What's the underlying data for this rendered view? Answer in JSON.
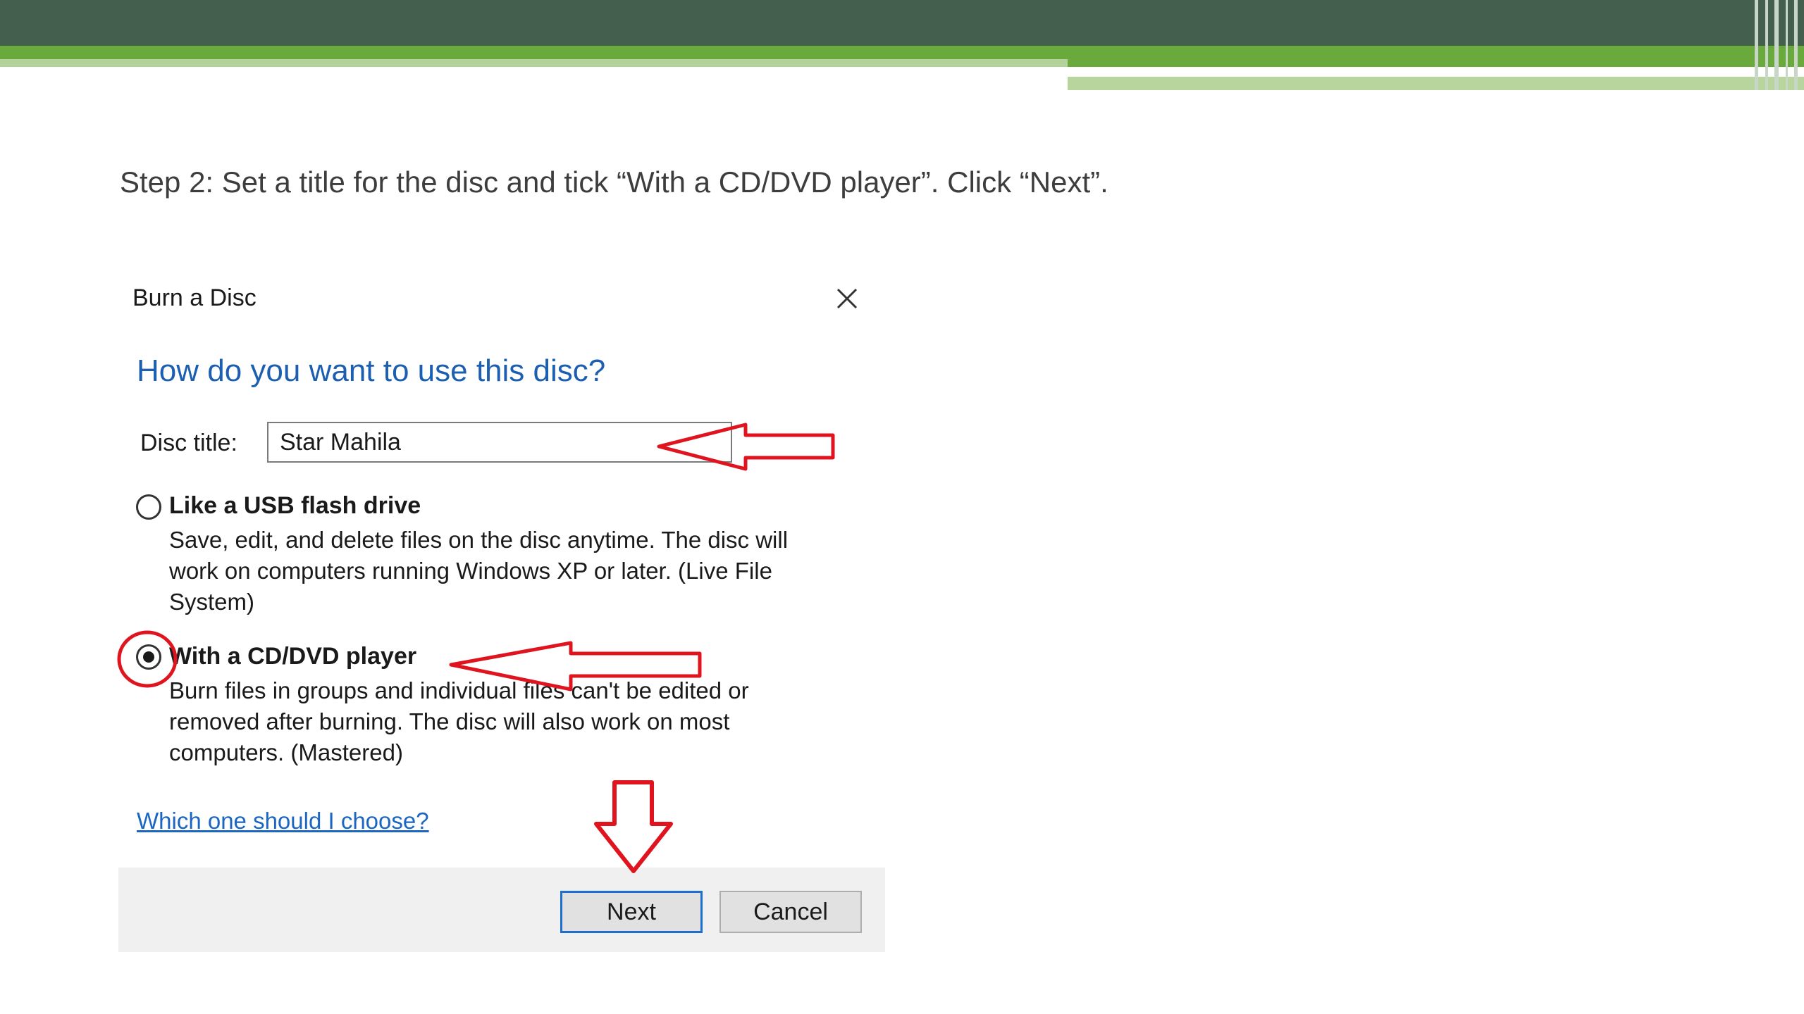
{
  "slide": {
    "instruction": "Step 2: Set a title for the disc and tick “With a CD/DVD player”. Click “Next”.",
    "header_colors": {
      "dark": "#455f4f",
      "green": "#6aaa3c",
      "pale": "#b4d39a"
    }
  },
  "dialog": {
    "title": "Burn a Disc",
    "close_icon": "close-icon",
    "heading": "How do you want to use this disc?",
    "disc_title_label": "Disc title:",
    "disc_title_value": "Star Mahila",
    "options": [
      {
        "label": "Like a USB flash drive",
        "description": "Save, edit, and delete files on the disc anytime. The disc will work on computers running Windows XP or later. (Live File System)",
        "selected": false
      },
      {
        "label": "With a CD/DVD player",
        "description": "Burn files in groups and individual files can't be edited or removed after burning. The disc will also work on most computers. (Mastered)",
        "selected": true
      }
    ],
    "help_link": "Which one should I choose?",
    "buttons": {
      "next": "Next",
      "cancel": "Cancel"
    },
    "accent_color": "#1c5fb0"
  },
  "annotations": {
    "color": "#e0141e",
    "items": [
      "arrow-to-disc-title",
      "circle-around-cd-radio",
      "arrow-to-cd-option",
      "down-arrow-to-next"
    ]
  }
}
